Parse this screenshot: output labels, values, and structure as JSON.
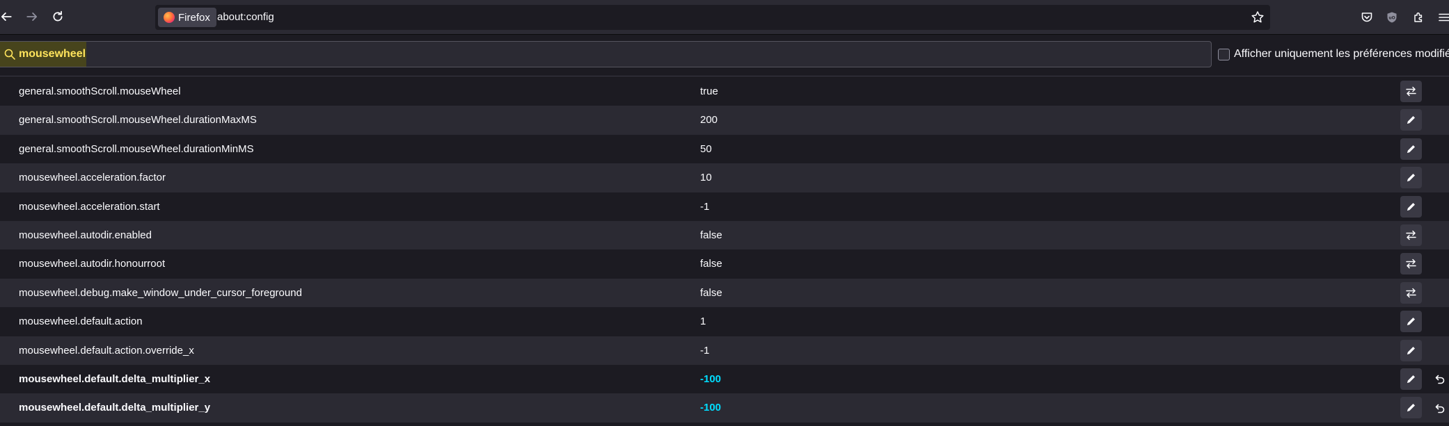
{
  "browser": {
    "identity_label": "Firefox",
    "url": "about:config"
  },
  "icons": {
    "back": "back-arrow-icon",
    "forward": "forward-arrow-icon",
    "reload": "reload-icon",
    "star": "bookmark-star-icon",
    "pocket": "pocket-icon",
    "ublock": "ublock-origin-icon",
    "extensions": "extensions-puzzle-icon",
    "menu": "hamburger-menu-icon",
    "toggle": "toggle-arrows-icon",
    "edit": "pencil-icon",
    "reset": "reset-arrow-icon"
  },
  "search": {
    "value": "mousewheel",
    "checkbox_label": "Afficher uniquement les préférences modifiées",
    "checkbox_checked": false
  },
  "colors": {
    "modified_value": "#00ddff",
    "search_highlight": "#ffe45c"
  },
  "prefs": [
    {
      "name": "general.smoothScroll.mouseWheel",
      "value": "true",
      "action": "toggle",
      "modified": false
    },
    {
      "name": "general.smoothScroll.mouseWheel.durationMaxMS",
      "value": "200",
      "action": "edit",
      "modified": false
    },
    {
      "name": "general.smoothScroll.mouseWheel.durationMinMS",
      "value": "50",
      "action": "edit",
      "modified": false
    },
    {
      "name": "mousewheel.acceleration.factor",
      "value": "10",
      "action": "edit",
      "modified": false
    },
    {
      "name": "mousewheel.acceleration.start",
      "value": "-1",
      "action": "edit",
      "modified": false
    },
    {
      "name": "mousewheel.autodir.enabled",
      "value": "false",
      "action": "toggle",
      "modified": false
    },
    {
      "name": "mousewheel.autodir.honourroot",
      "value": "false",
      "action": "toggle",
      "modified": false
    },
    {
      "name": "mousewheel.debug.make_window_under_cursor_foreground",
      "value": "false",
      "action": "toggle",
      "modified": false
    },
    {
      "name": "mousewheel.default.action",
      "value": "1",
      "action": "edit",
      "modified": false
    },
    {
      "name": "mousewheel.default.action.override_x",
      "value": "-1",
      "action": "edit",
      "modified": false
    },
    {
      "name": "mousewheel.default.delta_multiplier_x",
      "value": "-100",
      "action": "edit",
      "modified": true
    },
    {
      "name": "mousewheel.default.delta_multiplier_y",
      "value": "-100",
      "action": "edit",
      "modified": true
    }
  ]
}
